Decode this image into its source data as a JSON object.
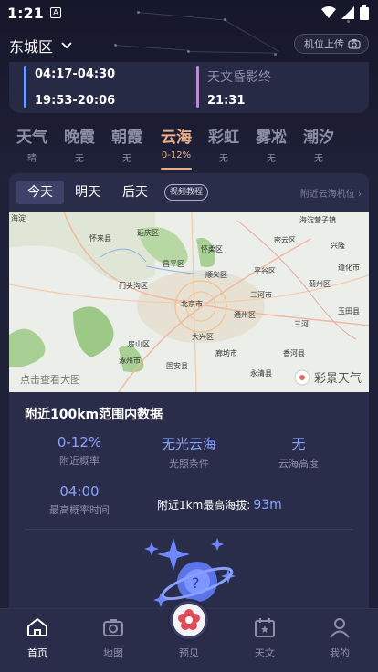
{
  "status": {
    "time": "1:21"
  },
  "header": {
    "location": "东城区",
    "upload_label": "机位上传"
  },
  "timing": {
    "row1_range": "04:17-04:30",
    "row2_range": "19:53-20:06",
    "right_label": "天文昏影终",
    "right_time": "21:31"
  },
  "tabs": [
    {
      "label": "天气",
      "sub": "晴"
    },
    {
      "label": "晚霞",
      "sub": "无"
    },
    {
      "label": "朝霞",
      "sub": "无"
    },
    {
      "label": "云海",
      "sub": "0-12%"
    },
    {
      "label": "彩虹",
      "sub": "无"
    },
    {
      "label": "雾凇",
      "sub": "无"
    },
    {
      "label": "潮汐",
      "sub": "无"
    }
  ],
  "day_tabs": [
    "今天",
    "明天",
    "后天"
  ],
  "tutorial_label": "视频教程",
  "nearby_link": "附近云海机位",
  "map": {
    "labels": [
      "海淀",
      "怀来县",
      "延庆区",
      "怀柔区",
      "密云区",
      "海淀营子镇",
      "昌平区",
      "顺义区",
      "平谷区",
      "门头沟区",
      "北京市",
      "三河市",
      "通州区",
      "蓟州区",
      "房山区",
      "大兴区",
      "廊坊市",
      "兴隆",
      "遵化市",
      "三河",
      "玉田县",
      "涿州市",
      "固安县",
      "香河县",
      "永清县"
    ],
    "footer_left": "点击查看大图",
    "footer_right": "彩景天气"
  },
  "data_section": {
    "title": "附近100km范围内数据",
    "probability": {
      "value": "0-12%",
      "label": "附近概率"
    },
    "light": {
      "value": "无光云海",
      "label": "光照条件"
    },
    "height": {
      "value": "无",
      "label": "云海高度"
    },
    "peak_time": {
      "value": "04:00",
      "label": "最高概率时间"
    },
    "altitude": {
      "label": "附近1km最高海拔:",
      "value": "93m"
    }
  },
  "nav": [
    {
      "label": "首页"
    },
    {
      "label": "地图"
    },
    {
      "label": "预见"
    },
    {
      "label": "天文"
    },
    {
      "label": "我的"
    }
  ],
  "colors": {
    "accent": "#e8b08a",
    "value_blue": "#8aa2ff",
    "bg": "#1f2138"
  }
}
